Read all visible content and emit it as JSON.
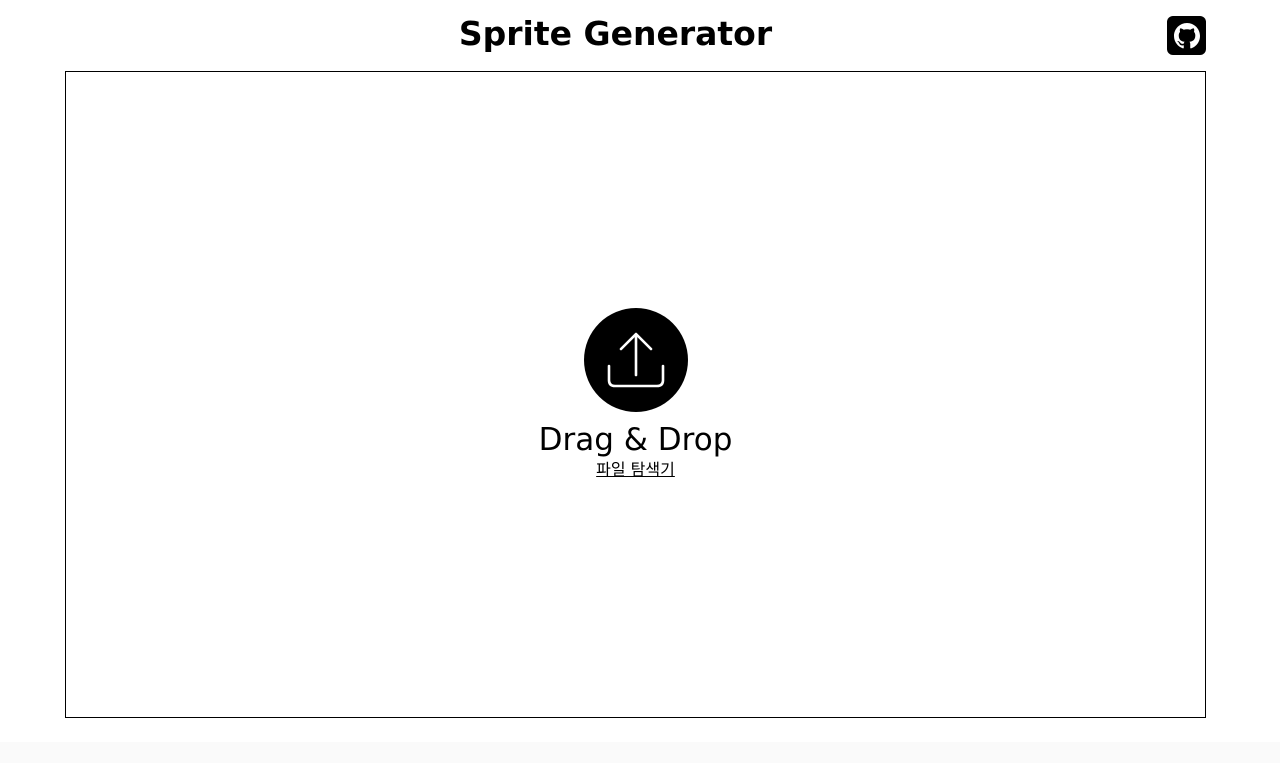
{
  "header": {
    "title": "Sprite Generator",
    "github_icon": "github-icon"
  },
  "dropzone": {
    "icon": "upload-icon",
    "title": "Drag & Drop",
    "file_link": "파일 탐색기"
  },
  "colors": {
    "foreground": "#000000",
    "background": "#ffffff",
    "page_bottom": "#fafafa"
  }
}
